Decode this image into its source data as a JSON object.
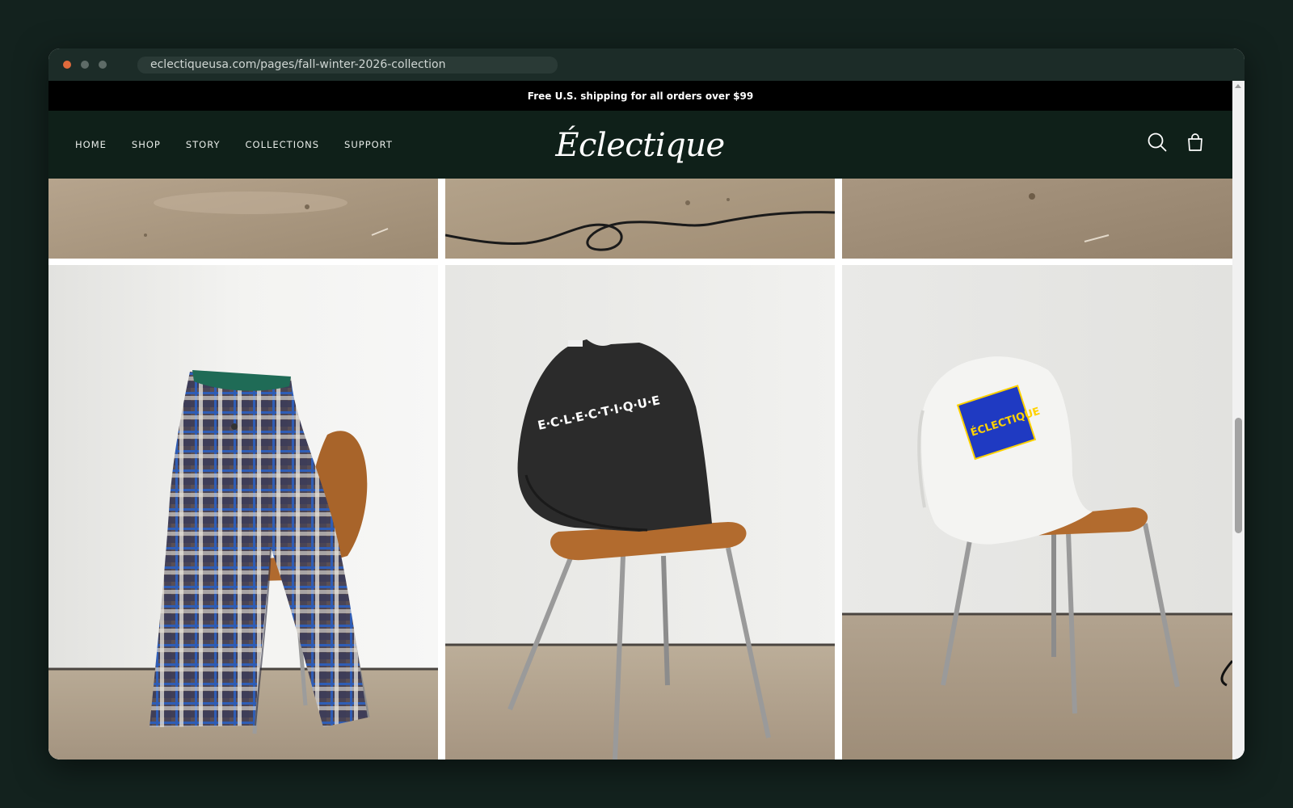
{
  "browser": {
    "url": "eclectiqueusa.com/pages/fall-winter-2026-collection"
  },
  "announcement": {
    "text": "Free U.S. shipping for all orders over $99"
  },
  "header": {
    "nav": [
      "HOME",
      "SHOP",
      "STORY",
      "COLLECTIONS",
      "SUPPORT"
    ],
    "logo_text": "Éclectique",
    "icons": [
      "search-icon",
      "bag-icon"
    ]
  },
  "gallery": {
    "tiles": [
      {
        "subject": "studio concrete floor"
      },
      {
        "subject": "studio floor with black cable"
      },
      {
        "subject": "studio concrete floor"
      },
      {
        "subject": "plaid wool trousers draped on wooden chair",
        "colors": [
          "#4b4b63",
          "#2f5db5",
          "#e9e6dc",
          "#1f6b56"
        ]
      },
      {
        "subject": "black t-shirt with logo print on wooden chair",
        "print_text": "E·C·L·E·C·T·I·Q·U·E"
      },
      {
        "subject": "white t-shirt with blue and yellow logo print on wooden chair",
        "print_text": "ÉCLECTIQUE"
      }
    ]
  },
  "colors": {
    "header_bg": "#0f2019",
    "announcement_bg": "#000000",
    "page_bg": "#13221e"
  }
}
